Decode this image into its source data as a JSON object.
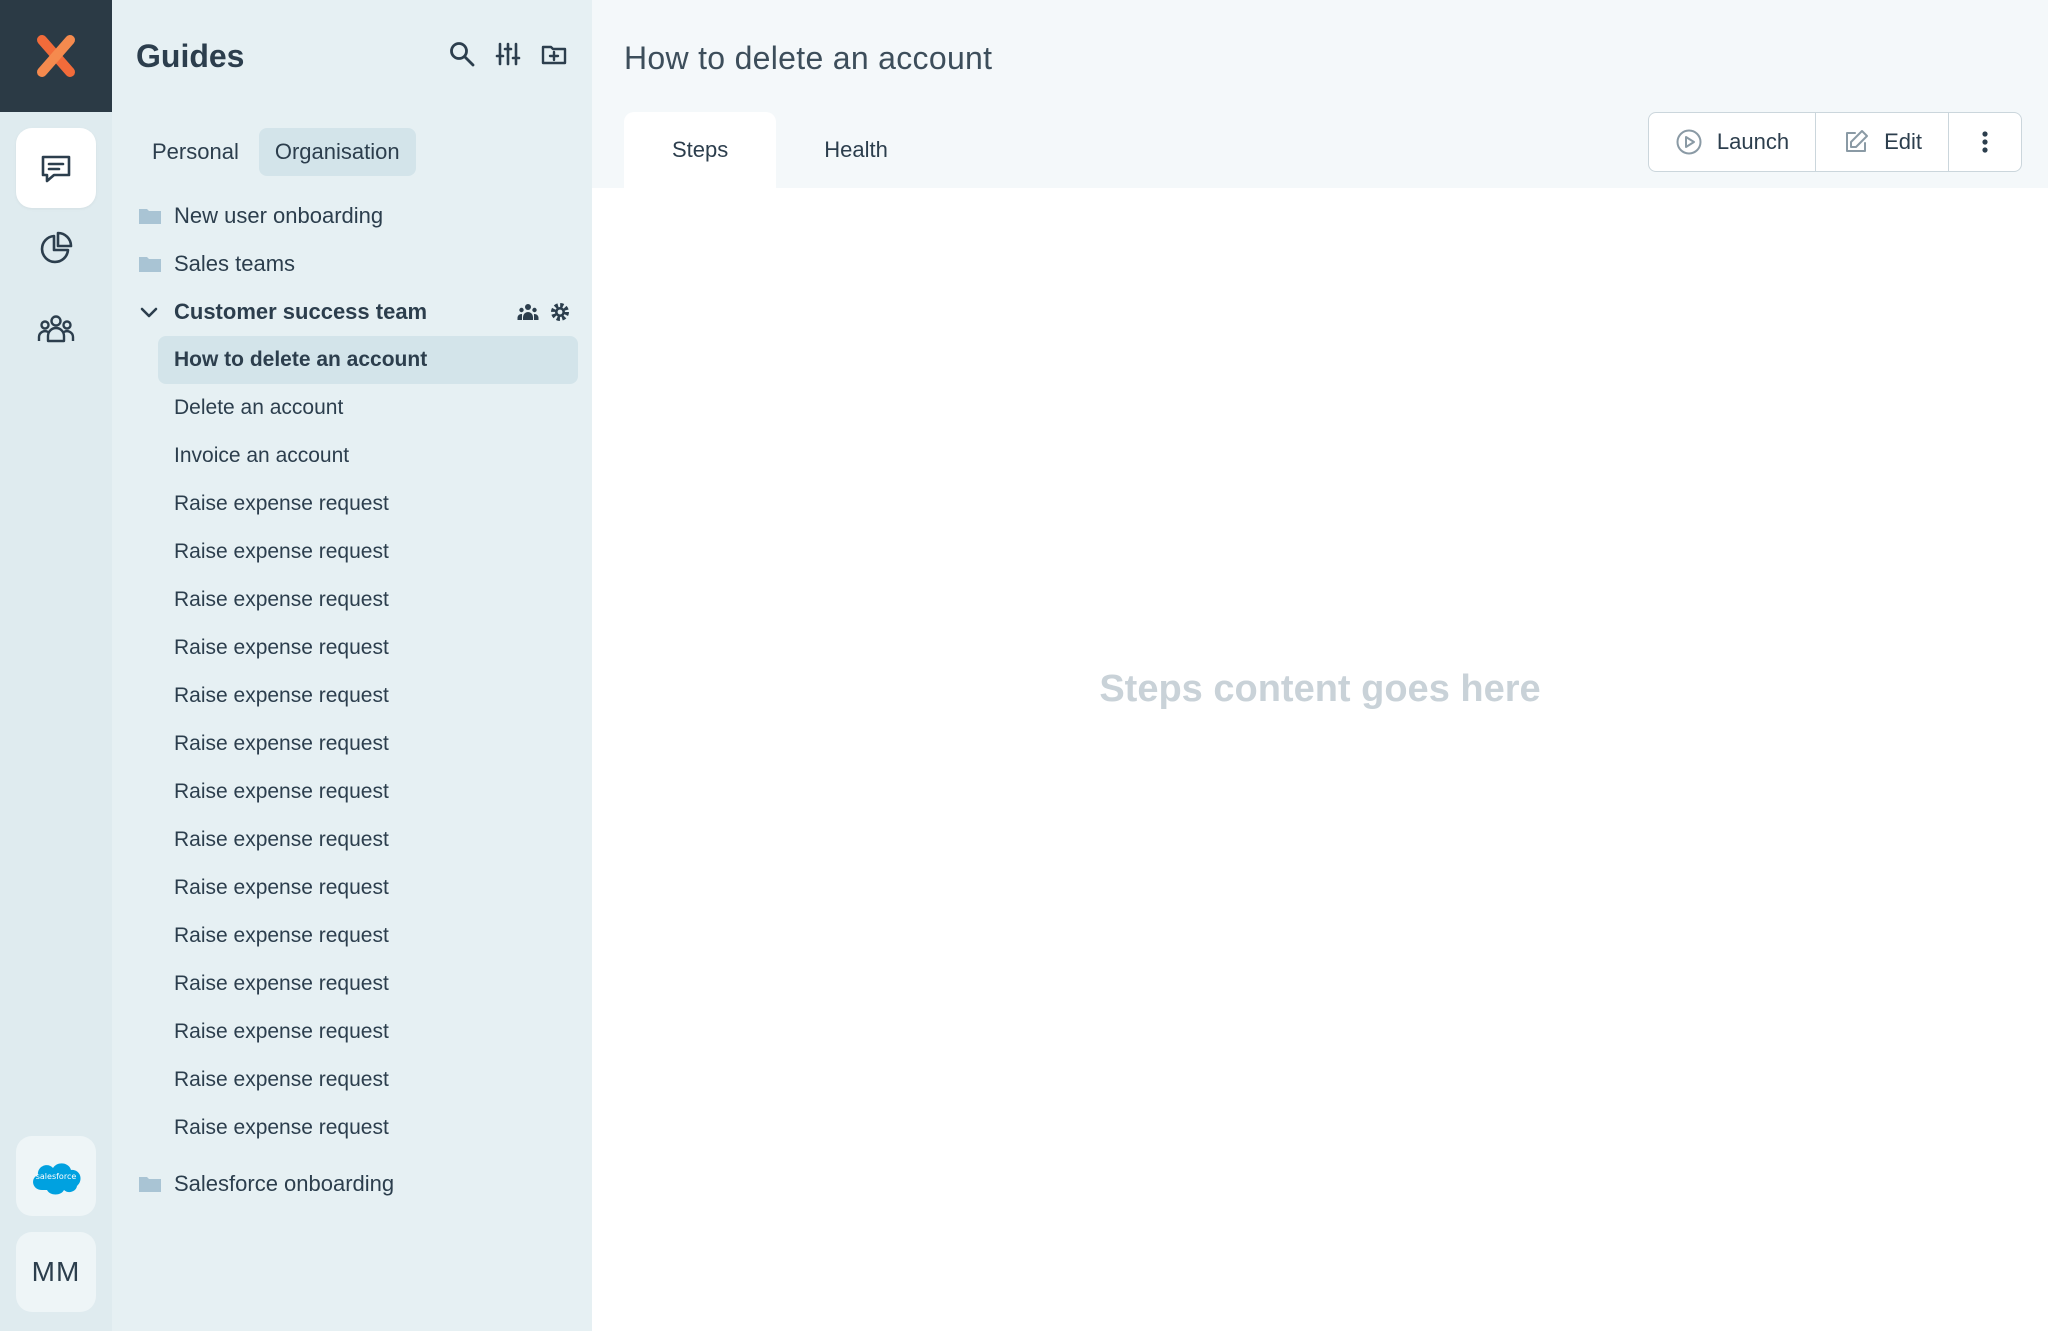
{
  "rail": {
    "items": [
      {
        "name": "guides",
        "icon": "chat-icon",
        "active": true
      },
      {
        "name": "analytics",
        "icon": "pie-chart-icon",
        "active": false
      },
      {
        "name": "users",
        "icon": "team-icon",
        "active": false
      }
    ],
    "integration_logo_text": "salesforce",
    "avatar_initials": "MM"
  },
  "sidebar": {
    "title": "Guides",
    "tabs": [
      {
        "label": "Personal",
        "active": false
      },
      {
        "label": "Organisation",
        "active": true
      }
    ],
    "folders_top": [
      {
        "label": "New user onboarding"
      },
      {
        "label": "Sales teams"
      }
    ],
    "open_folder": {
      "label": "Customer success team",
      "guides": [
        {
          "label": "How to delete an account",
          "selected": true
        },
        {
          "label": "Delete an account"
        },
        {
          "label": "Invoice an account"
        },
        {
          "label": "Raise expense request"
        },
        {
          "label": "Raise expense request"
        },
        {
          "label": "Raise expense request"
        },
        {
          "label": "Raise expense request"
        },
        {
          "label": "Raise expense request"
        },
        {
          "label": "Raise expense request"
        },
        {
          "label": "Raise expense request"
        },
        {
          "label": "Raise expense request"
        },
        {
          "label": "Raise expense request"
        },
        {
          "label": "Raise expense request"
        },
        {
          "label": "Raise expense request"
        },
        {
          "label": "Raise expense request"
        },
        {
          "label": "Raise expense request"
        },
        {
          "label": "Raise expense request"
        }
      ]
    },
    "folders_bottom": [
      {
        "label": "Salesforce onboarding"
      }
    ]
  },
  "main": {
    "title": "How to delete an account",
    "tabs": [
      {
        "label": "Steps",
        "active": true
      },
      {
        "label": "Health",
        "active": false
      }
    ],
    "actions": {
      "launch_label": "Launch",
      "edit_label": "Edit"
    },
    "placeholder": "Steps content goes here"
  },
  "colors": {
    "brand_orange": "#f26b3a",
    "logo_bg": "#2b3a45",
    "folder_icon": "#a9c4d4",
    "selected_bg": "#d3e4ea"
  }
}
